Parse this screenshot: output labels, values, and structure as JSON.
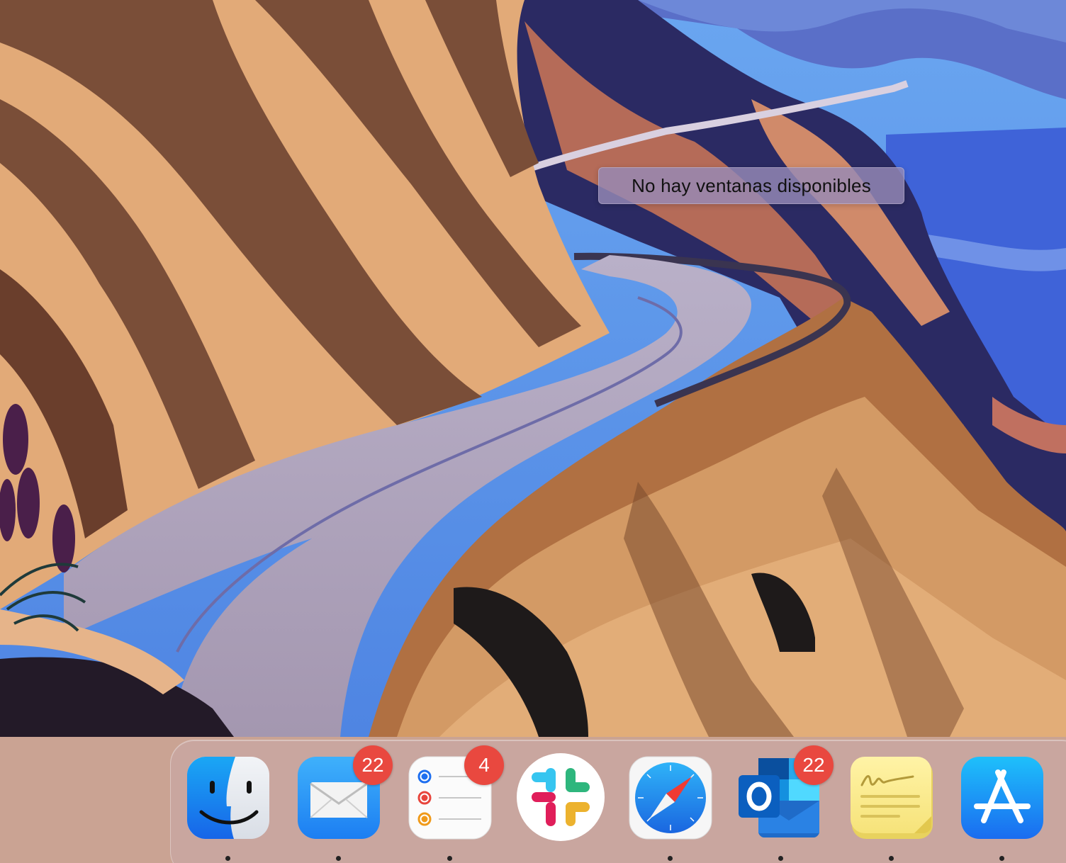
{
  "desktop": {
    "tooltip": "No hay ventanas disponibles"
  },
  "dock": {
    "items": [
      {
        "app": "Finder",
        "icon": "finder-icon",
        "badge": null,
        "running": true
      },
      {
        "app": "Mail",
        "icon": "mail-icon",
        "badge": "22",
        "running": true
      },
      {
        "app": "Recordatorios",
        "icon": "reminders-icon",
        "badge": "4",
        "running": true
      },
      {
        "app": "Slack",
        "icon": "slack-icon",
        "badge": null,
        "running": false
      },
      {
        "app": "Safari",
        "icon": "safari-icon",
        "badge": null,
        "running": true
      },
      {
        "app": "Outlook",
        "icon": "outlook-icon",
        "badge": "22",
        "running": true
      },
      {
        "app": "Notas",
        "icon": "stickies-icon",
        "badge": null,
        "running": true
      },
      {
        "app": "App Store",
        "icon": "app-store-icon",
        "badge": null,
        "running": true
      }
    ]
  },
  "colors": {
    "badge": "#e9483f",
    "sea": "#3f63d8",
    "cliff": "#c88a55",
    "road": "#a99db6"
  }
}
